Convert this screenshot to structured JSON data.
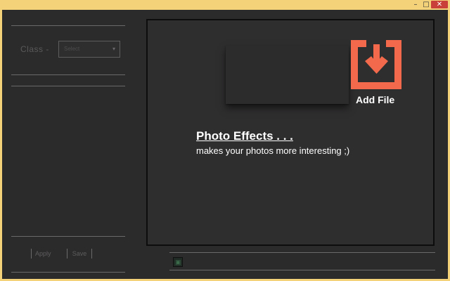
{
  "window": {
    "minimize_glyph": "–",
    "maximize_glyph": "□",
    "close_glyph": "✕"
  },
  "sidebar": {
    "class_label": "Class -",
    "class_select_value": "Select",
    "caret_glyph": "▾",
    "apply_label": "Apply",
    "save_label": "Save"
  },
  "main": {
    "add_file_label": "Add File",
    "add_file_icon": "download-icon",
    "add_file_color": "#f26a4b",
    "title": "Photo Effects . . .",
    "subtitle": "makes your photos more interesting ;)"
  },
  "thumbnail": {
    "icon": "image-thumbnail-icon",
    "glyph": "▣"
  }
}
